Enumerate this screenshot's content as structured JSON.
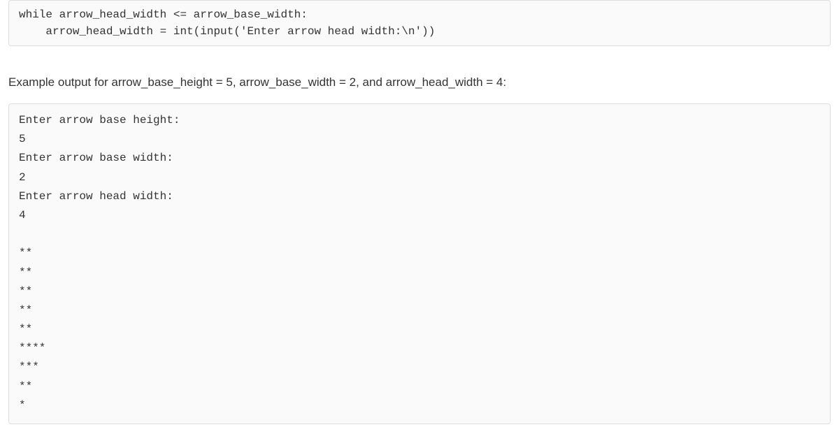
{
  "code_block": {
    "content": "while arrow_head_width <= arrow_base_width:\n    arrow_head_width = int(input('Enter arrow head width:\\n'))"
  },
  "description": {
    "text": "Example output for arrow_base_height = 5, arrow_base_width = 2, and arrow_head_width = 4:"
  },
  "output_block": {
    "content": "Enter arrow base height:\n5\nEnter arrow base width:\n2\nEnter arrow head width:\n4\n\n**\n**\n**\n**\n**\n****\n***\n**\n*"
  }
}
